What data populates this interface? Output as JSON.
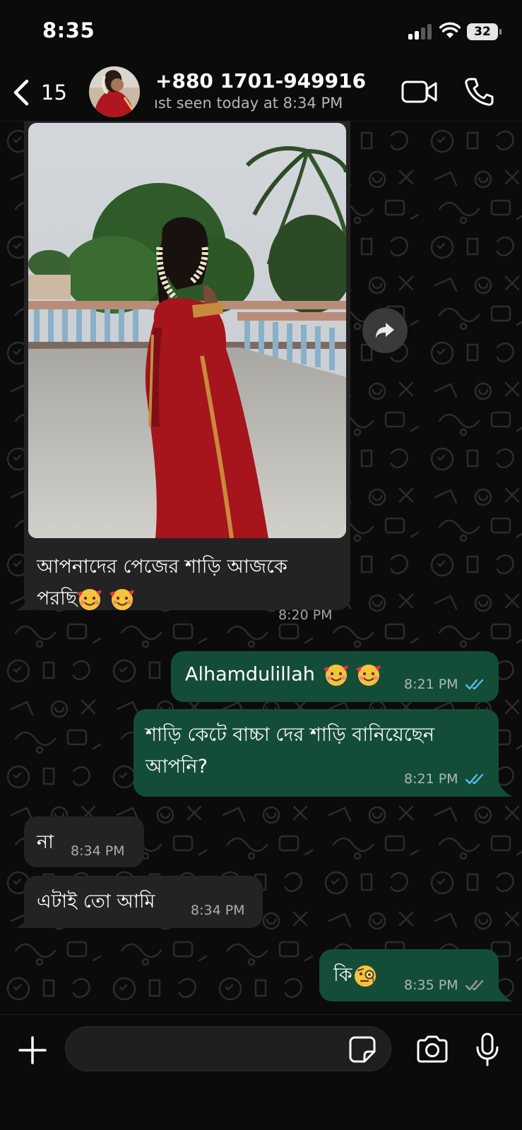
{
  "status_bar": {
    "time": "8:35",
    "battery": "32"
  },
  "header": {
    "back_count": "15",
    "contact_name": "+880 1701-949916",
    "last_seen": "ıst seen today at 8:34 PM",
    "icons": [
      "chevron-left-icon",
      "video-call-icon",
      "phone-icon"
    ]
  },
  "messages": [
    {
      "direction": "incoming",
      "type": "image",
      "caption_line1": "আপনাদের পেজের শাড়ি আজকে",
      "caption_line2": "পরছি",
      "time": "8:20 PM",
      "emoji": "smiling-face-with-hearts"
    },
    {
      "direction": "outgoing",
      "text": "Alhamdulillah",
      "time": "8:21 PM",
      "status": "read",
      "emoji": "smiling-face-with-hearts"
    },
    {
      "direction": "outgoing",
      "text_line1": "শাড়ি কেটে বাচ্চা দের শাড়ি বানিয়েছেন",
      "text_line2": "আপনি?",
      "time": "8:21 PM",
      "status": "read"
    },
    {
      "direction": "incoming",
      "text": "না",
      "time": "8:34 PM"
    },
    {
      "direction": "incoming",
      "text": "এটাই তো  আমি",
      "time": "8:34 PM"
    },
    {
      "direction": "outgoing",
      "text": "কি",
      "time": "8:35 PM",
      "status": "delivered",
      "emoji": "face-with-monocle"
    }
  ],
  "composer": {
    "icons": [
      "plus-icon",
      "sticker-icon",
      "camera-icon",
      "microphone-icon"
    ]
  },
  "colors": {
    "background": "#0b0b0b",
    "incoming_bubble": "#232323",
    "outgoing_bubble": "#144d37",
    "read_ticks": "#53bdeb",
    "delivered_ticks": "#9a9a9a"
  }
}
